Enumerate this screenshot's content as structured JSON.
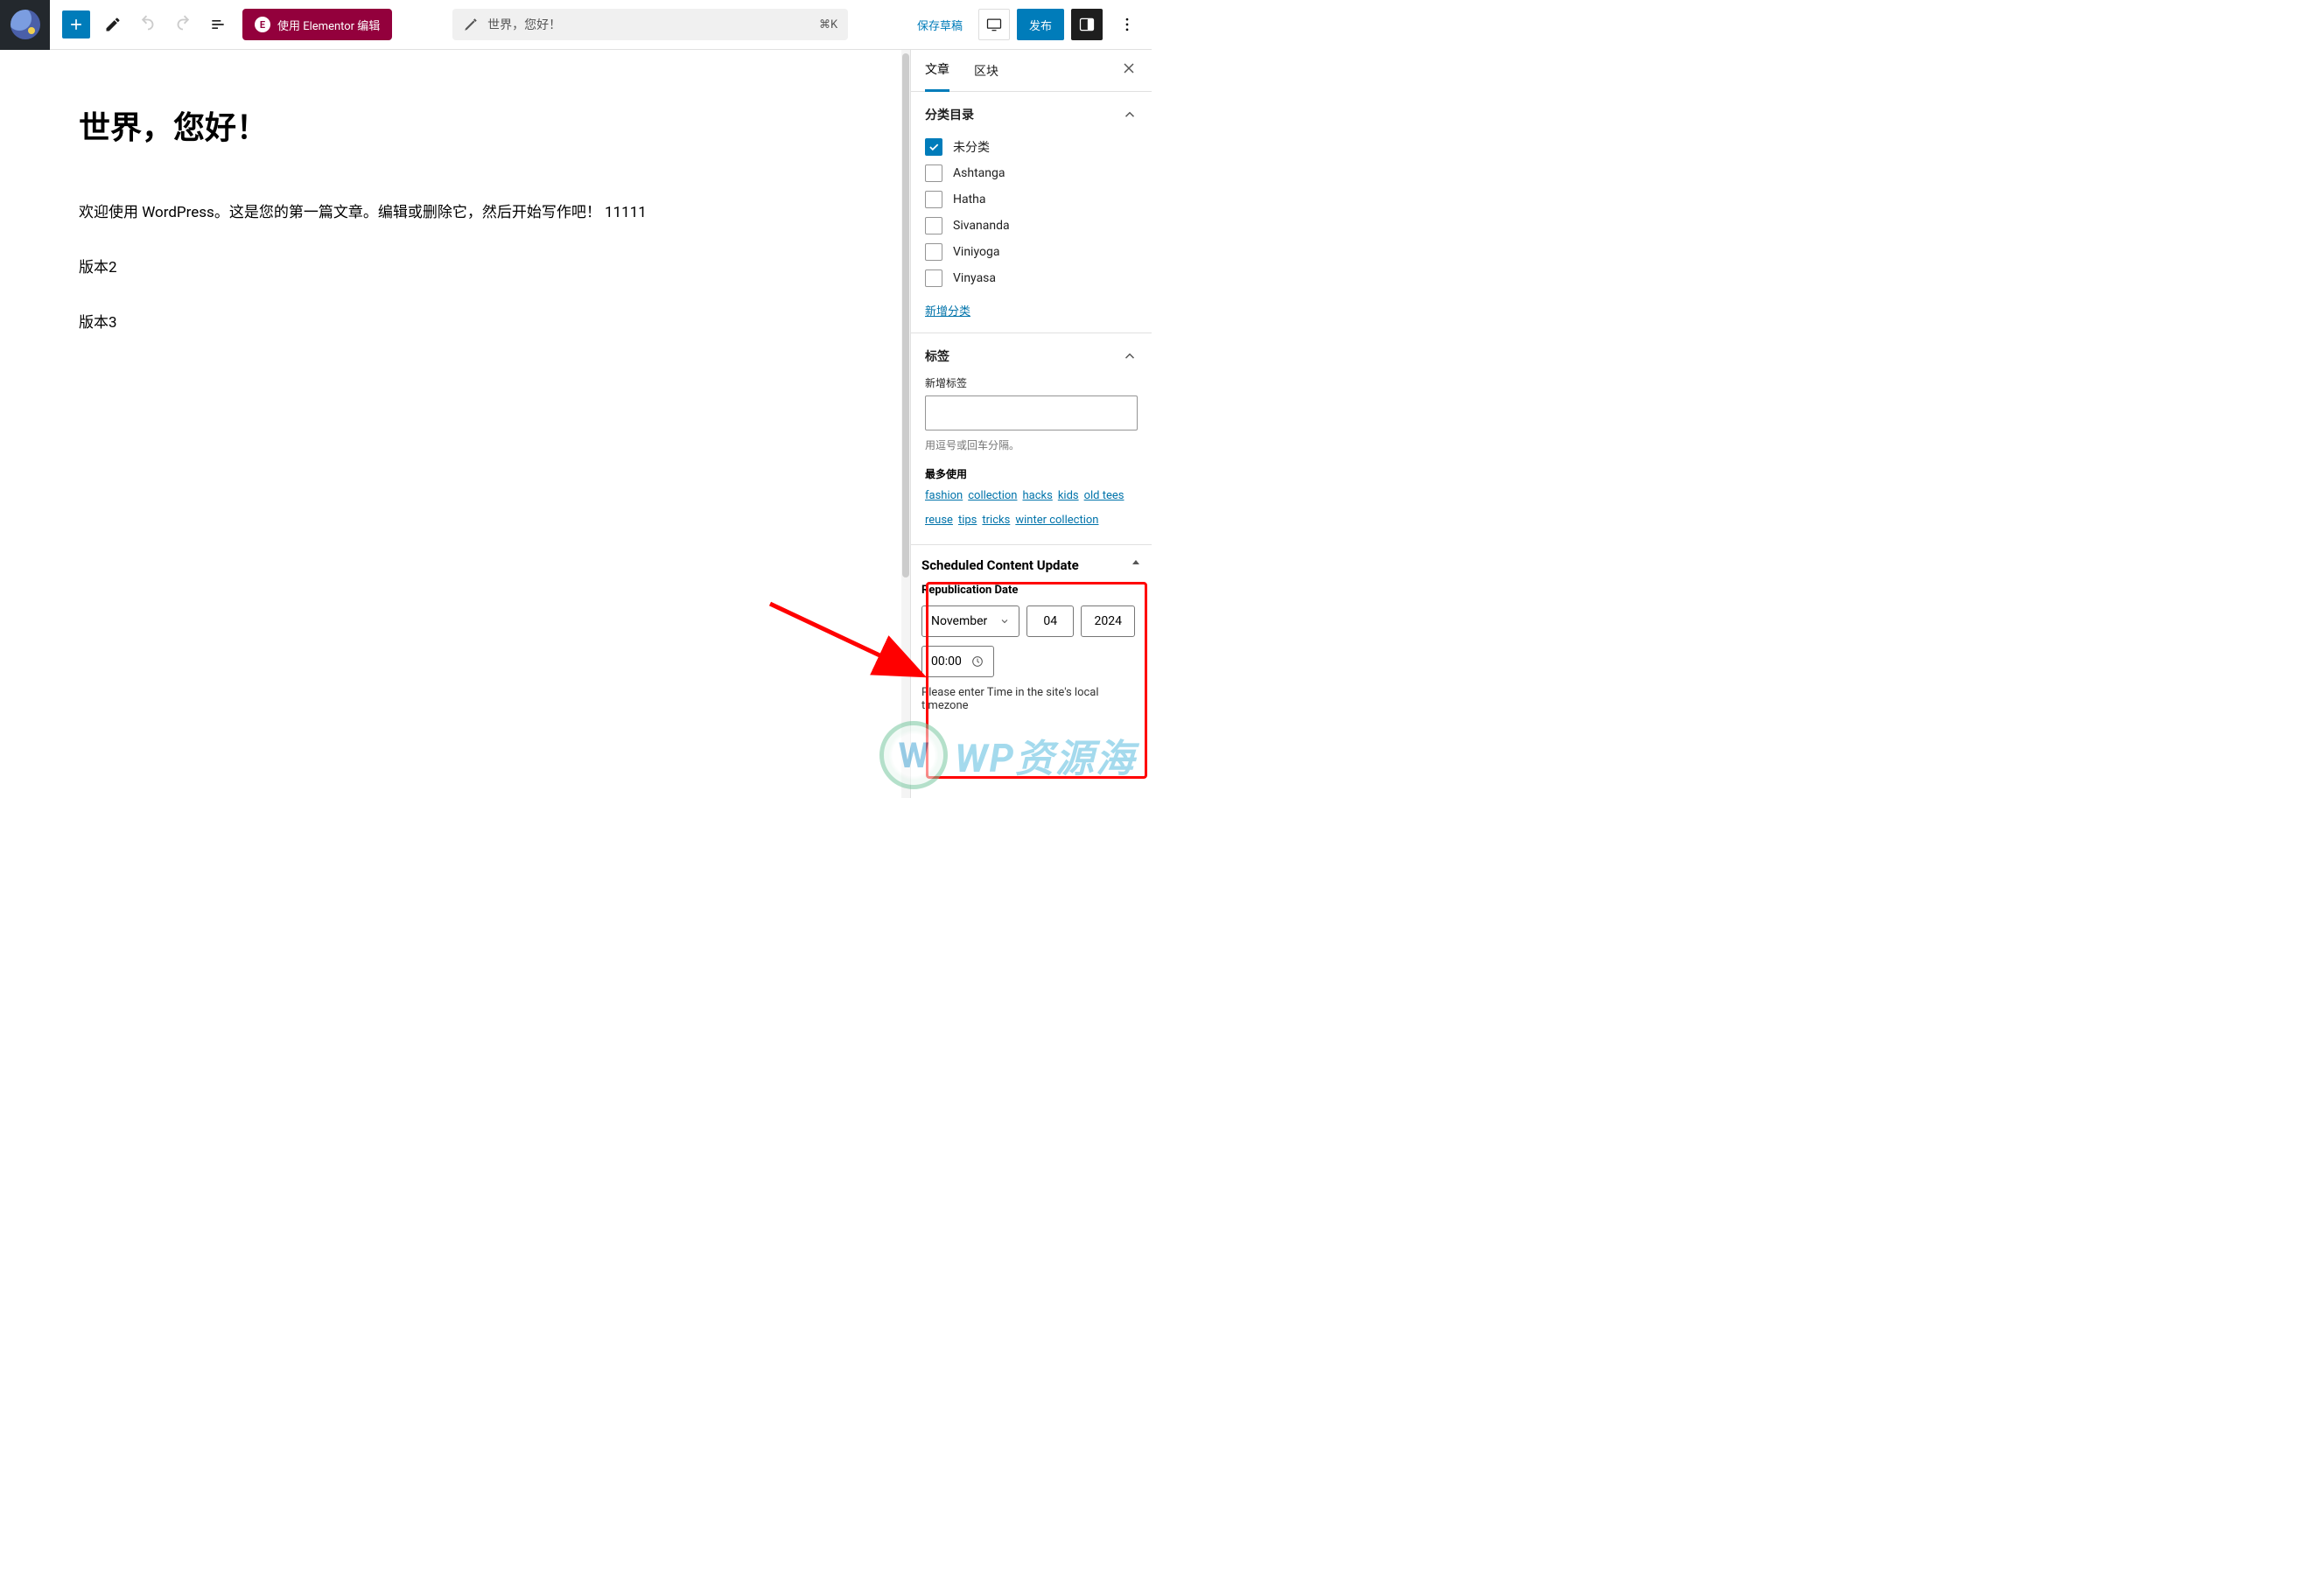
{
  "topbar": {
    "elementor_btn": "使用 Elementor 编辑",
    "search_title": "世界，您好！",
    "search_kbd": "⌘K",
    "save_draft": "保存草稿",
    "publish": "发布"
  },
  "editor": {
    "title": "世界，您好！",
    "paragraphs": [
      "欢迎使用 WordPress。这是您的第一篇文章。编辑或删除它，然后开始写作吧！ 11111",
      "版本2",
      "版本3"
    ]
  },
  "sidebar": {
    "tabs": {
      "post": "文章",
      "block": "区块"
    },
    "categories": {
      "title": "分类目录",
      "items": [
        {
          "label": "未分类",
          "checked": true
        },
        {
          "label": "Ashtanga",
          "checked": false
        },
        {
          "label": "Hatha",
          "checked": false
        },
        {
          "label": "Sivananda",
          "checked": false
        },
        {
          "label": "Viniyoga",
          "checked": false
        },
        {
          "label": "Vinyasa",
          "checked": false
        }
      ],
      "add_new": "新增分类"
    },
    "tags": {
      "title": "标签",
      "add_label": "新增标签",
      "hint": "用逗号或回车分隔。",
      "most_used_label": "最多使用",
      "most_used": [
        "fashion",
        "collection",
        "hacks",
        "kids",
        "old tees",
        "reuse",
        "tips",
        "tricks",
        "winter collection"
      ]
    },
    "scu": {
      "title": "Scheduled Content Update",
      "sub": "Republication Date",
      "month": "November",
      "day": "04",
      "year": "2024",
      "time": "00:00",
      "note": "Please enter Time in the site's local timezone"
    }
  },
  "watermark": {
    "text": "WP资源海"
  },
  "annotation": {
    "arrow_color": "#ff0000"
  }
}
